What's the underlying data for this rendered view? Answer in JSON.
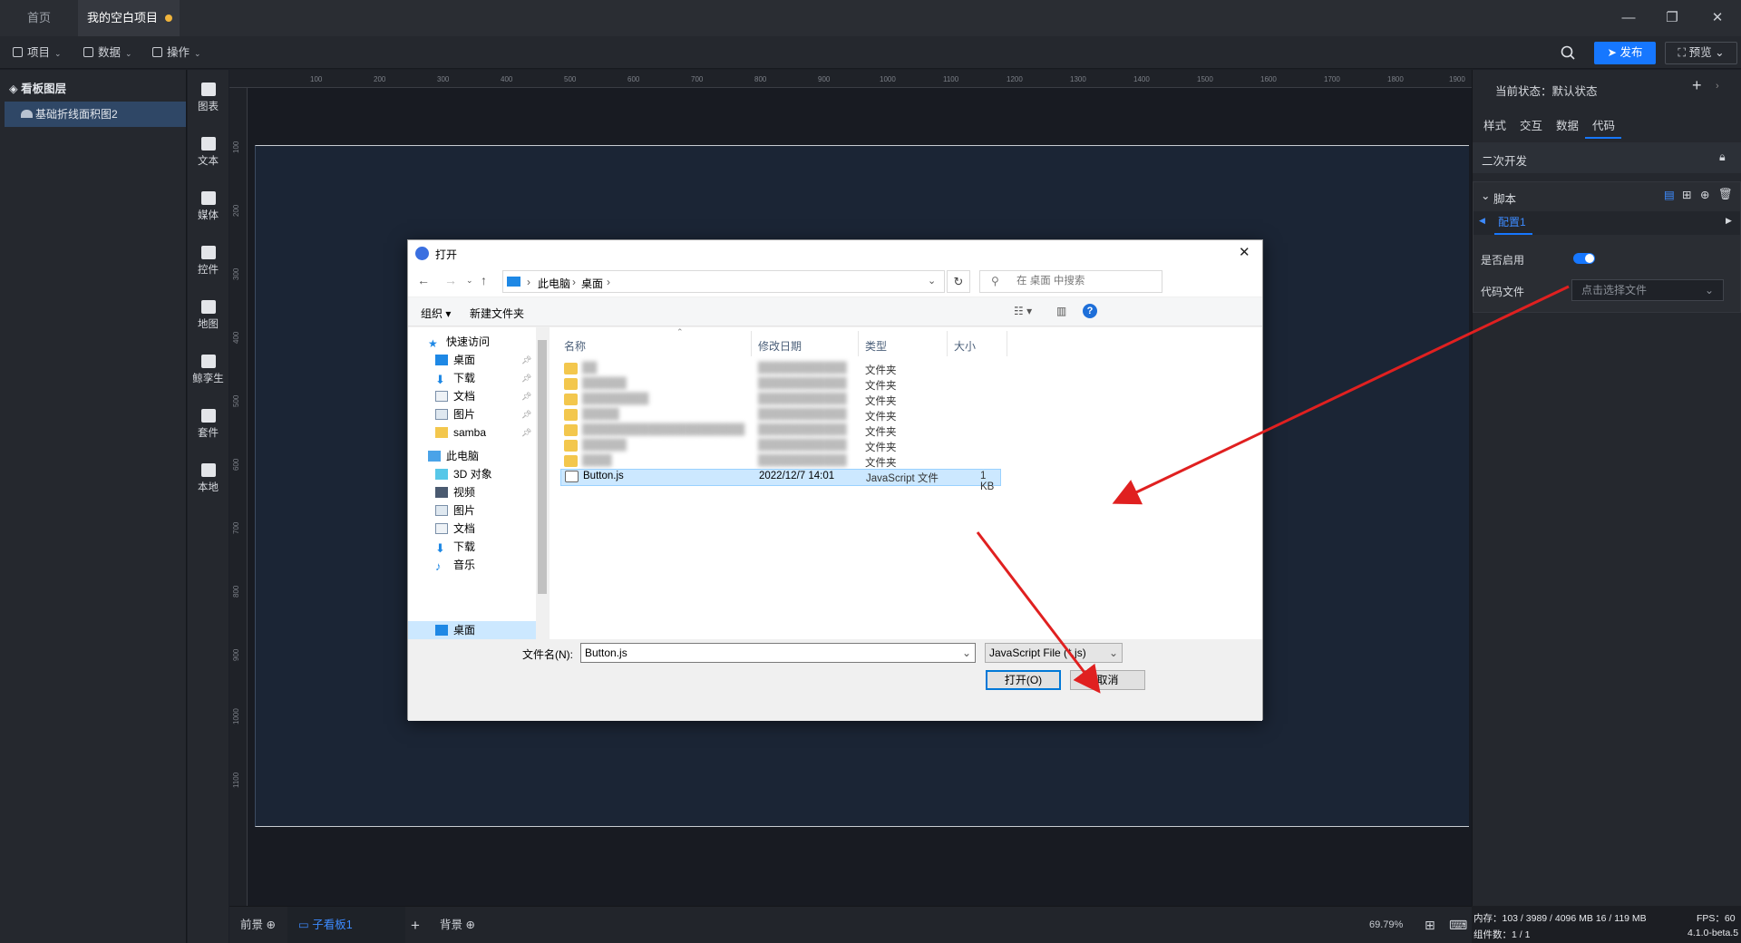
{
  "tabs": {
    "home": "首页",
    "project": "我的空白项目"
  },
  "toolbar": {
    "project": "项目",
    "data": "数据",
    "operate": "操作",
    "publish": "发布",
    "preview": "预览"
  },
  "layers": {
    "title": "看板图层",
    "item": "基础折线面积图2"
  },
  "components": [
    "图表",
    "文本",
    "媒体",
    "控件",
    "地图",
    "鲸孪生",
    "套件",
    "本地"
  ],
  "ruler": {
    "top": [
      "100",
      "200",
      "300",
      "400",
      "500",
      "600",
      "700",
      "800",
      "900",
      "1000",
      "1100",
      "1200",
      "1300",
      "1400",
      "1500",
      "1600",
      "1700",
      "1800",
      "1900"
    ],
    "left": [
      "100",
      "200",
      "300",
      "400",
      "500",
      "600",
      "700",
      "800",
      "900",
      "1000",
      "1100"
    ]
  },
  "bottombar": {
    "front": "前景",
    "board": "子看板1",
    "back": "背景",
    "zoom": "69.79%"
  },
  "right": {
    "state": "当前状态：默认状态",
    "tabs": [
      "样式",
      "交互",
      "数据",
      "代码"
    ],
    "dev": "二次开发",
    "script": "脚本",
    "config": "配置1",
    "enable": "是否启用",
    "code_file": "代码文件",
    "file_placeholder": "点击选择文件"
  },
  "status": {
    "mem": "内存：103 / 3989 / 4096 MB 16 / 119 MB",
    "fps": "FPS：60",
    "count": "组件数：1 / 1",
    "version": "4.1.0-beta.5"
  },
  "dialog": {
    "title": "打开",
    "path": [
      "此电脑",
      "桌面"
    ],
    "search": "在 桌面 中搜索",
    "organize": "组织",
    "new_folder": "新建文件夹",
    "nav": [
      {
        "label": "快速访问",
        "pin": false
      },
      {
        "label": "桌面",
        "pin": true
      },
      {
        "label": "下载",
        "pin": true
      },
      {
        "label": "文档",
        "pin": true
      },
      {
        "label": "图片",
        "pin": true
      },
      {
        "label": "samba",
        "pin": true
      },
      {
        "label": "此电脑",
        "pin": false
      },
      {
        "label": "3D 对象",
        "pin": false
      },
      {
        "label": "视频",
        "pin": false
      },
      {
        "label": "图片",
        "pin": false
      },
      {
        "label": "文档",
        "pin": false
      },
      {
        "label": "下载",
        "pin": false
      },
      {
        "label": "音乐",
        "pin": false
      },
      {
        "label": "桌面",
        "pin": false
      }
    ],
    "columns": {
      "name": "名称",
      "date": "修改日期",
      "type": "类型",
      "size": "大小"
    },
    "folder_type": "文件夹",
    "file": {
      "name": "Button.js",
      "date": "2022/12/7 14:01",
      "type": "JavaScript 文件",
      "size": "1 KB"
    },
    "filename_label": "文件名(N):",
    "filename": "Button.js",
    "filter": "JavaScript File (*.js)",
    "open": "打开(O)",
    "cancel": "取消"
  },
  "colors": {
    "accent": "#1677ff",
    "arrow": "#e02020"
  }
}
